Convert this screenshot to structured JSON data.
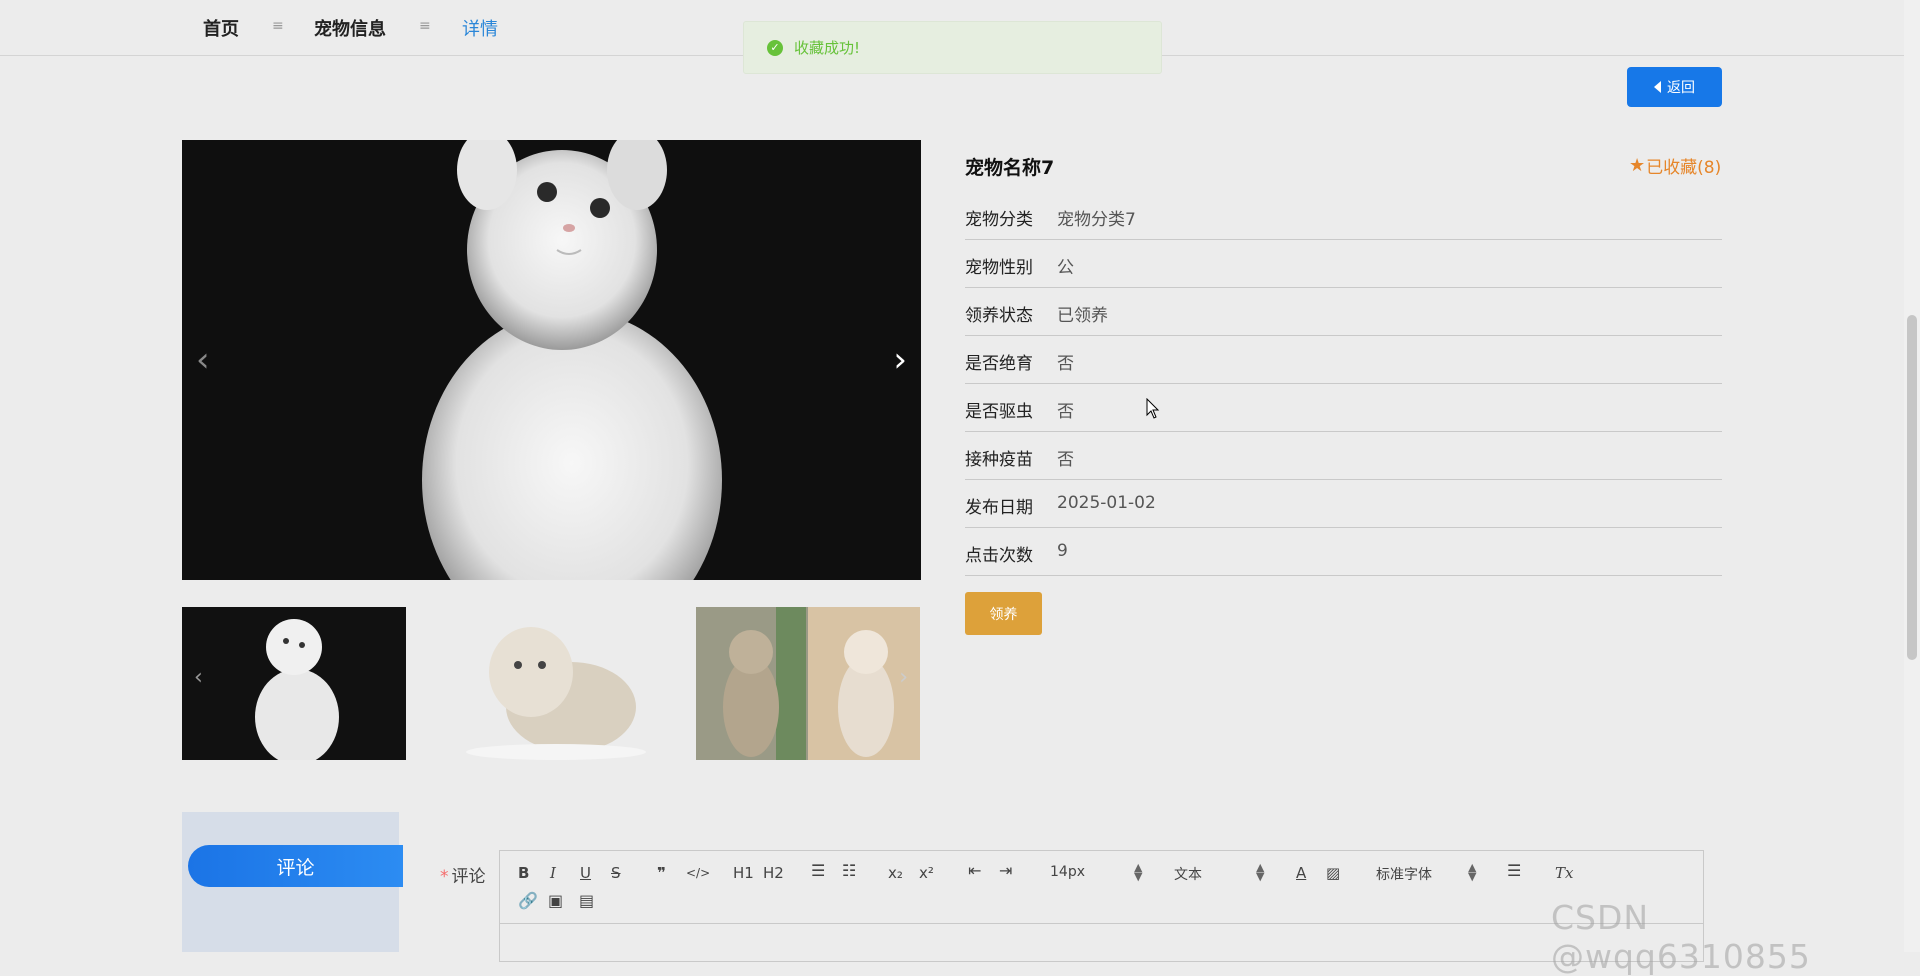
{
  "nav": {
    "home": "首页",
    "pets": "宠物信息",
    "detail": "详情",
    "separator": "≡"
  },
  "toast": {
    "message": "收藏成功!"
  },
  "back_label": "返回",
  "pet": {
    "name": "宠物名称7",
    "favorite_label": "已收藏(8)",
    "rows": [
      {
        "label": "宠物分类",
        "value": "宠物分类7"
      },
      {
        "label": "宠物性别",
        "value": "公"
      },
      {
        "label": "领养状态",
        "value": "已领养"
      },
      {
        "label": "是否绝育",
        "value": "否"
      },
      {
        "label": "是否驱虫",
        "value": "否"
      },
      {
        "label": "接种疫苗",
        "value": "否"
      },
      {
        "label": "发布日期",
        "value": "2025-01-02"
      },
      {
        "label": "点击次数",
        "value": "9"
      }
    ],
    "adopt_label": "领养"
  },
  "comment": {
    "tab_label": "评论",
    "field_label": "评论",
    "required_mark": "*",
    "toolbar": {
      "bold": "B",
      "italic": "I",
      "underline": "U",
      "strike": "S",
      "quote": "❞",
      "code": "</>",
      "h1": "H1",
      "h2": "H2",
      "subscript": "x₂",
      "superscript": "x²",
      "size": "14px",
      "format": "文本",
      "font": "标准字体",
      "clear": "Tx"
    }
  },
  "watermark": "CSDN @wqq6310855",
  "colors": {
    "primary": "#1778e8",
    "accent": "#dda13a",
    "favorite": "#e6862a",
    "success": "#67c23a"
  }
}
